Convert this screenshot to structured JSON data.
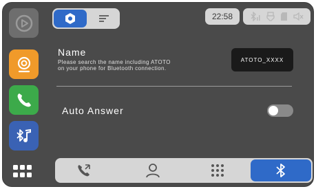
{
  "status": {
    "time": "22:58"
  },
  "bluetooth_settings": {
    "name_label": "Name",
    "name_hint_line1": "Please search the name including ATOTO",
    "name_hint_line2": "on your phone for Bluetooth connection.",
    "device_name": "ATOTO_XXXX",
    "auto_answer_label": "Auto Answer",
    "auto_answer_enabled": false
  },
  "sidebar": {
    "apps": [
      {
        "icon": "carplay-icon"
      },
      {
        "icon": "camera-icon"
      },
      {
        "icon": "phone-icon"
      },
      {
        "icon": "bluetooth-music-icon"
      },
      {
        "icon": "app-grid-icon"
      }
    ]
  },
  "top_tabs": [
    {
      "icon": "settings-hex-icon",
      "active": true
    },
    {
      "icon": "list-icon",
      "active": false
    }
  ],
  "bottom_tabs": [
    {
      "icon": "call-log-icon",
      "active": false
    },
    {
      "icon": "contacts-icon",
      "active": false
    },
    {
      "icon": "dialpad-icon",
      "active": false
    },
    {
      "icon": "bluetooth-icon",
      "active": true
    }
  ],
  "colors": {
    "accent": "#2f6ac8",
    "background": "#4a4a4a",
    "camera_tile": "#f09a2a",
    "phone_tile": "#3caa4a",
    "bt_tile": "#3a62b4"
  }
}
